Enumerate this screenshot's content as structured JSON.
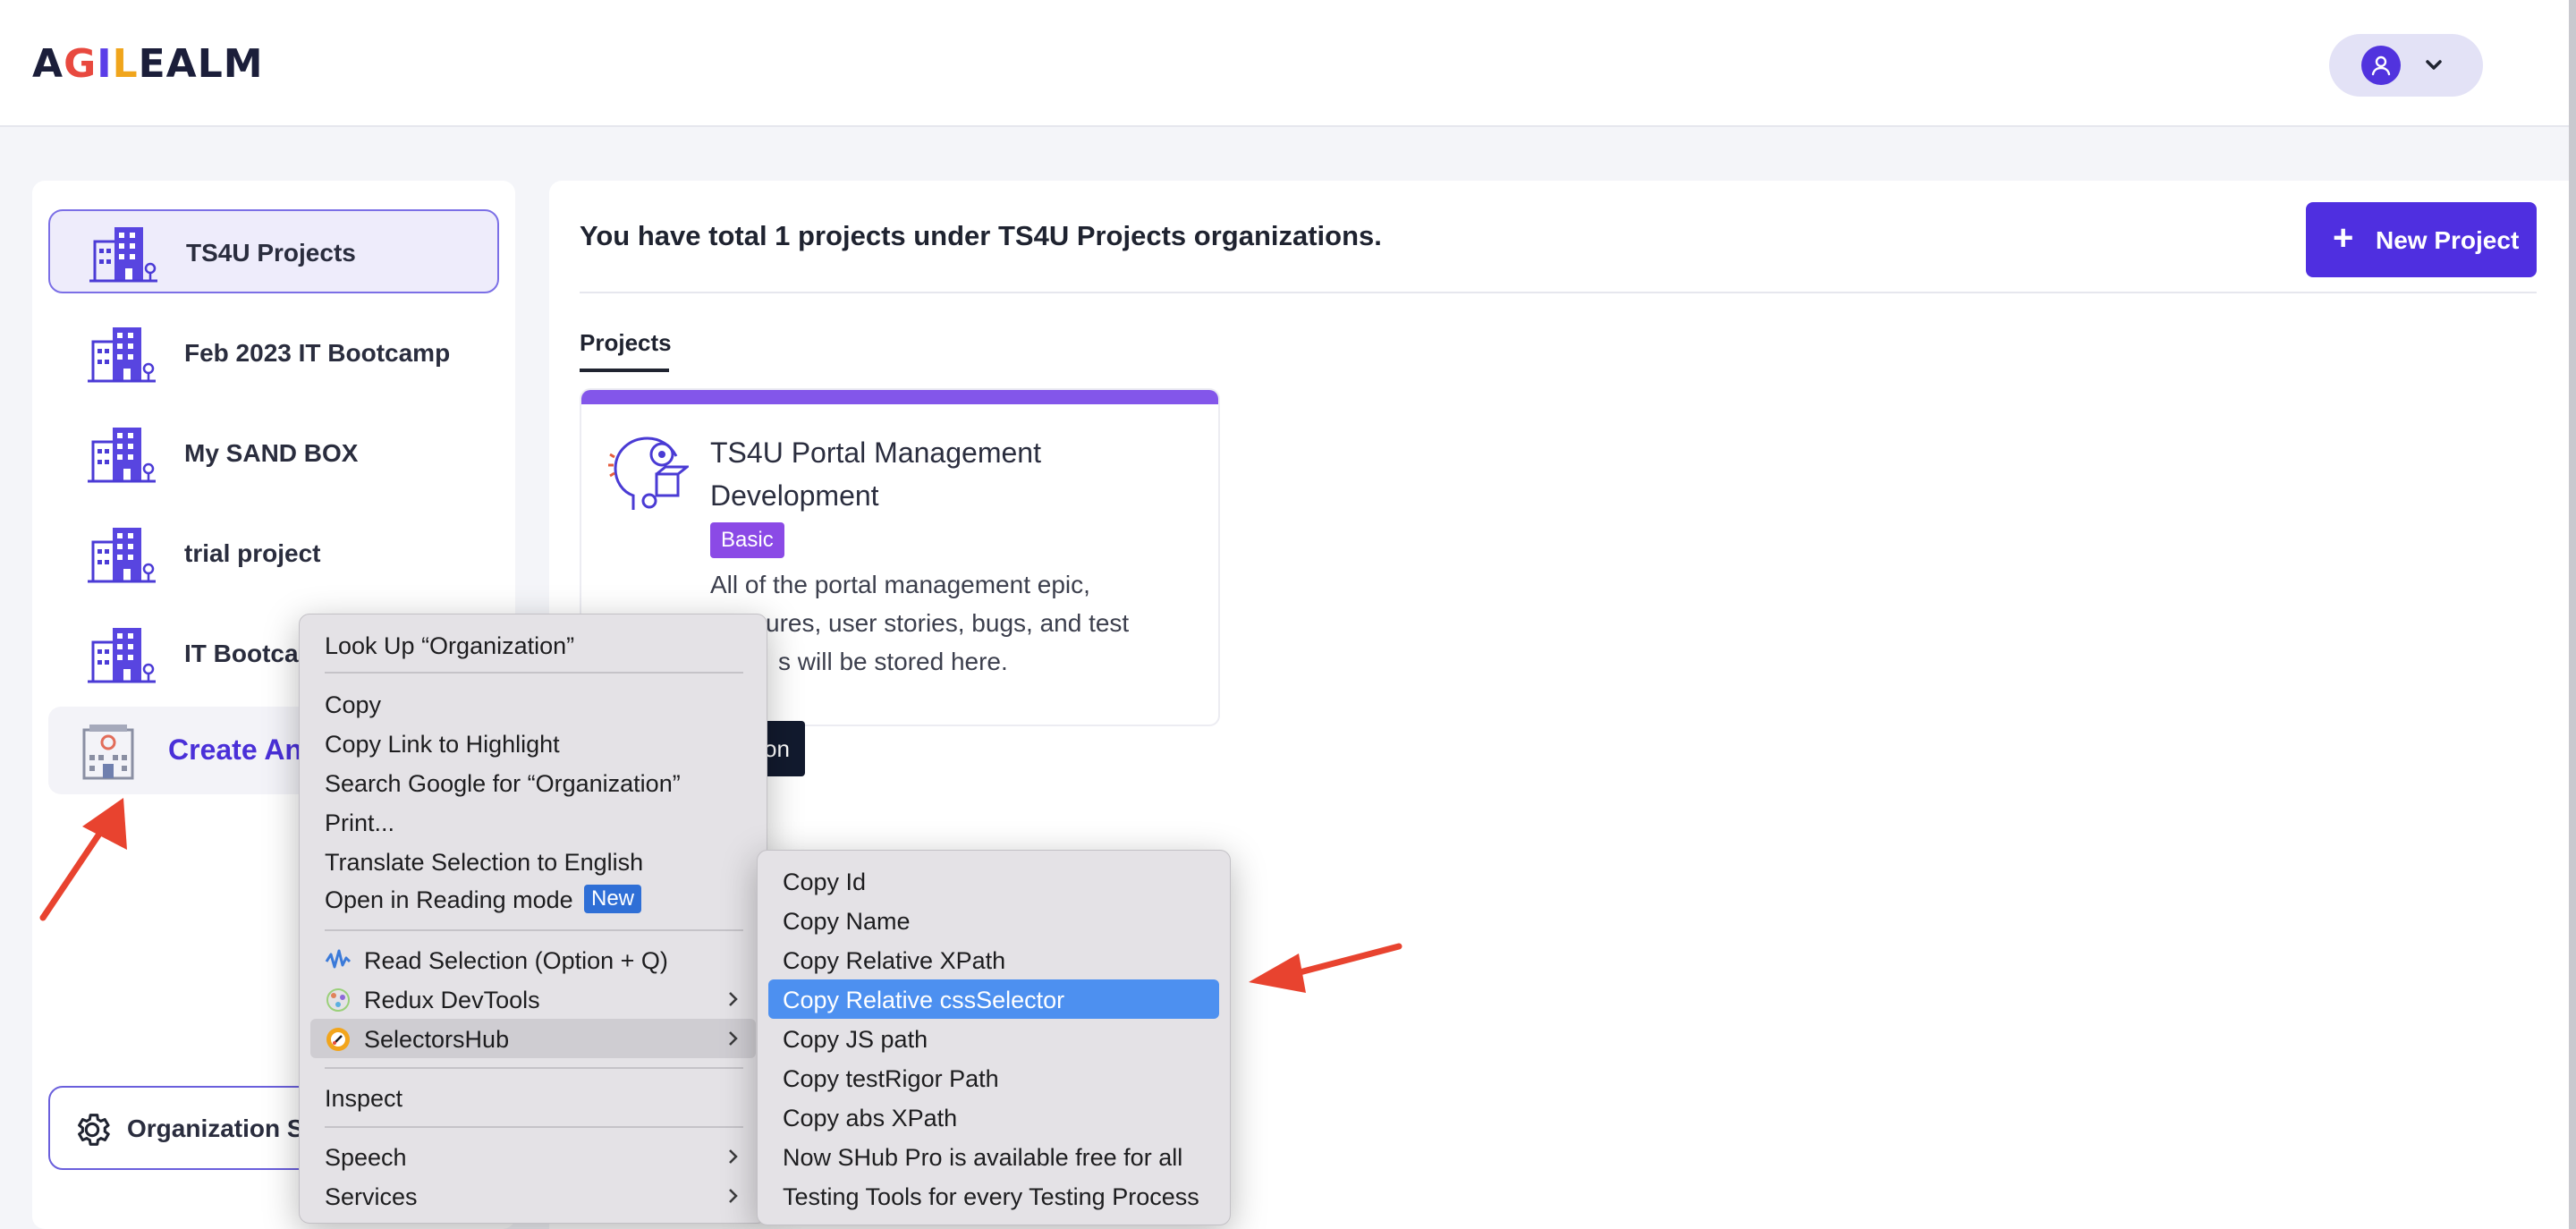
{
  "header": {
    "logo": "AGILEALM",
    "logo_letters": [
      "A",
      "G",
      "I",
      "L",
      "E",
      "A",
      "L",
      "M"
    ]
  },
  "sidebar": {
    "items": [
      {
        "label": "TS4U Projects",
        "active": true
      },
      {
        "label": "Feb 2023 IT Bootcamp",
        "active": false
      },
      {
        "label": "My SAND BOX",
        "active": false
      },
      {
        "label": "trial project",
        "active": false
      },
      {
        "label": "IT Bootcam",
        "active": false
      }
    ],
    "create_label": "Create An ",
    "settings_label": "Organization S"
  },
  "main": {
    "heading": "You have total 1 projects under TS4U Projects organizations.",
    "new_project_label": "New Project",
    "new_project_icon": "+",
    "tab": "Projects",
    "card": {
      "title": "TS4U Portal Management Development",
      "badge": "Basic",
      "description": "All of the portal management epic, features, user stories, bugs, and test cases will be stored here.",
      "description_visible_lines": [
        "All of the portal management epic,",
        "ures, user stories, bugs, and test",
        "s will be stored here."
      ]
    },
    "tooltip_fragment": "on"
  },
  "context_menu": {
    "items": [
      {
        "label": "Look Up “Organization”"
      },
      {
        "label": "Copy"
      },
      {
        "label": "Copy Link to Highlight"
      },
      {
        "label": "Search Google for “Organization”"
      },
      {
        "label": "Print..."
      },
      {
        "label": "Translate Selection to English"
      },
      {
        "label": "Open in Reading mode",
        "badge": "New"
      },
      {
        "label": "Read Selection (Option + Q)",
        "icon": "waveform-icon"
      },
      {
        "label": "Redux DevTools",
        "icon": "redux-icon",
        "submenu": true
      },
      {
        "label": "SelectorsHub",
        "icon": "selectorshub-icon",
        "submenu": true,
        "highlighted": true
      },
      {
        "label": "Inspect"
      },
      {
        "label": "Speech",
        "submenu": true
      },
      {
        "label": "Services",
        "submenu": true
      }
    ]
  },
  "submenu": {
    "items": [
      {
        "label": "Copy Id"
      },
      {
        "label": "Copy Name"
      },
      {
        "label": "Copy Relative XPath"
      },
      {
        "label": "Copy Relative cssSelector",
        "selected": true
      },
      {
        "label": "Copy JS path"
      },
      {
        "label": "Copy testRigor Path"
      },
      {
        "label": "Copy abs XPath"
      },
      {
        "label": "Now SHub Pro is available free for all"
      },
      {
        "label": "Testing Tools for every Testing Process"
      }
    ]
  },
  "colors": {
    "brand": "#4f2fe0",
    "card_accent": "#8356ea",
    "badge": "#8b4ae6",
    "selection": "#4d90f0",
    "annotation_arrow": "#e8432f"
  }
}
